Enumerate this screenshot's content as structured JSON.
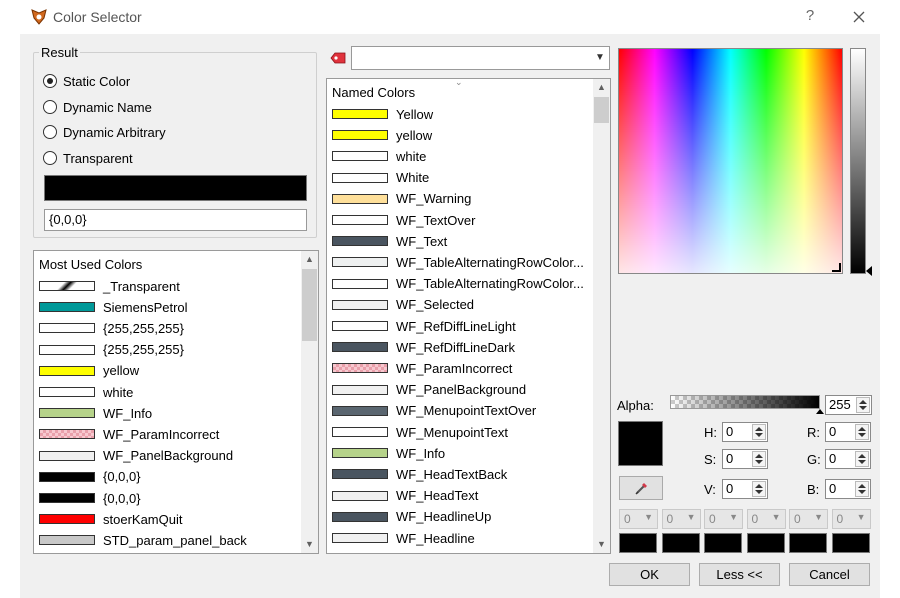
{
  "window": {
    "title": "Color Selector",
    "help": "?"
  },
  "result": {
    "group_title": "Result",
    "options": [
      {
        "label": "Static Color",
        "checked": true
      },
      {
        "label": "Dynamic Name",
        "checked": false
      },
      {
        "label": "Dynamic Arbitrary",
        "checked": false
      },
      {
        "label": "Transparent",
        "checked": false
      }
    ],
    "swatch_color": "#000000",
    "value": "{0,0,0}"
  },
  "most_used": {
    "header": "Most Used Colors",
    "items": [
      {
        "label": "_Transparent",
        "color": "transparent"
      },
      {
        "label": "SiemensPetrol",
        "color": "#009999"
      },
      {
        "label": "{255,255,255}",
        "color": "#ffffff"
      },
      {
        "label": "{255,255,255}",
        "color": "#ffffff"
      },
      {
        "label": "yellow",
        "color": "#ffff00"
      },
      {
        "label": "white",
        "color": "#ffffff"
      },
      {
        "label": "WF_Info",
        "color": "#b6d38a"
      },
      {
        "label": "WF_ParamIncorrect",
        "color": "pink-checker"
      },
      {
        "label": "WF_PanelBackground",
        "color": "#f0f0f0"
      },
      {
        "label": "{0,0,0}",
        "color": "#000000"
      },
      {
        "label": "{0,0,0}",
        "color": "#000000"
      },
      {
        "label": "stoerKamQuit",
        "color": "#ff0000"
      },
      {
        "label": "STD_param_panel_back",
        "color": "#c8c8c8"
      }
    ]
  },
  "named": {
    "combo_value": "",
    "header": "Named Colors",
    "items": [
      {
        "label": "Yellow",
        "color": "#ffff00"
      },
      {
        "label": "yellow",
        "color": "#ffff00"
      },
      {
        "label": "white",
        "color": "#ffffff"
      },
      {
        "label": "White",
        "color": "#ffffff"
      },
      {
        "label": "WF_Warning",
        "color": "#ffe09a"
      },
      {
        "label": "WF_TextOver",
        "color": "#ffffff"
      },
      {
        "label": "WF_Text",
        "color": "#4a5560"
      },
      {
        "label": "WF_TableAlternatingRowColor...",
        "color": "#eef0f0"
      },
      {
        "label": "WF_TableAlternatingRowColor...",
        "color": "#ffffff"
      },
      {
        "label": "WF_Selected",
        "color": "#f0f0f0"
      },
      {
        "label": "WF_RefDiffLineLight",
        "color": "#ffffff"
      },
      {
        "label": "WF_RefDiffLineDark",
        "color": "#4a5560"
      },
      {
        "label": "WF_ParamIncorrect",
        "color": "pink-checker"
      },
      {
        "label": "WF_PanelBackground",
        "color": "#f0f0f0"
      },
      {
        "label": "WF_MenupointTextOver",
        "color": "#5a6670"
      },
      {
        "label": "WF_MenupointText",
        "color": "#ffffff"
      },
      {
        "label": "WF_Info",
        "color": "#b6d38a"
      },
      {
        "label": "WF_HeadTextBack",
        "color": "#4a5560"
      },
      {
        "label": "WF_HeadText",
        "color": "#f0f0f0"
      },
      {
        "label": "WF_HeadlineUp",
        "color": "#4a5560"
      },
      {
        "label": "WF_Headline",
        "color": "#f0f0f0"
      }
    ]
  },
  "picker": {
    "alpha_label": "Alpha:",
    "alpha_value": "255",
    "alpha_level": 1.0,
    "h_label": "H:",
    "h_value": "0",
    "s_label": "S:",
    "s_value": "0",
    "v_label": "V:",
    "v_value": "0",
    "r_label": "R:",
    "r_value": "0",
    "g_label": "G:",
    "g_value": "0",
    "b_label": "B:",
    "b_value": "0",
    "preview_color": "#000000",
    "history": [
      {
        "value": "0",
        "color": "#000000"
      },
      {
        "value": "0",
        "color": "#000000"
      },
      {
        "value": "0",
        "color": "#000000"
      },
      {
        "value": "0",
        "color": "#000000"
      },
      {
        "value": "0",
        "color": "#000000"
      },
      {
        "value": "0",
        "color": "#000000"
      }
    ]
  },
  "buttons": {
    "ok": "OK",
    "less": "Less <<",
    "cancel": "Cancel"
  }
}
